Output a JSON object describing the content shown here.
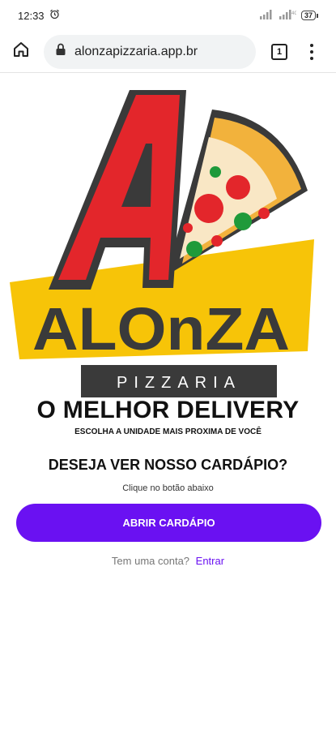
{
  "status_bar": {
    "time": "12:33",
    "battery": "37"
  },
  "browser": {
    "url": "alonzapizzaria.app.br",
    "tab_count": "1"
  },
  "logo": {
    "wordmark": "ALOnZA",
    "subword": "PIZZARIA",
    "colors": {
      "red": "#e3262b",
      "yellow": "#f7c408",
      "dark": "#3a3a3a",
      "crust": "#f2b23c"
    }
  },
  "main": {
    "headline": "O MELHOR DELIVERY",
    "subheadline": "ESCOLHA A UNIDADE MAIS PROXIMA DE VOCÊ",
    "question": "DESEJA VER NOSSO CARDÁPIO?",
    "hint": "Clique no botão abaixo",
    "cta_label": "ABRIR CARDÁPIO",
    "account_prompt": "Tem uma conta?",
    "login_link": "Entrar"
  },
  "accent_color": "#6a11f2"
}
